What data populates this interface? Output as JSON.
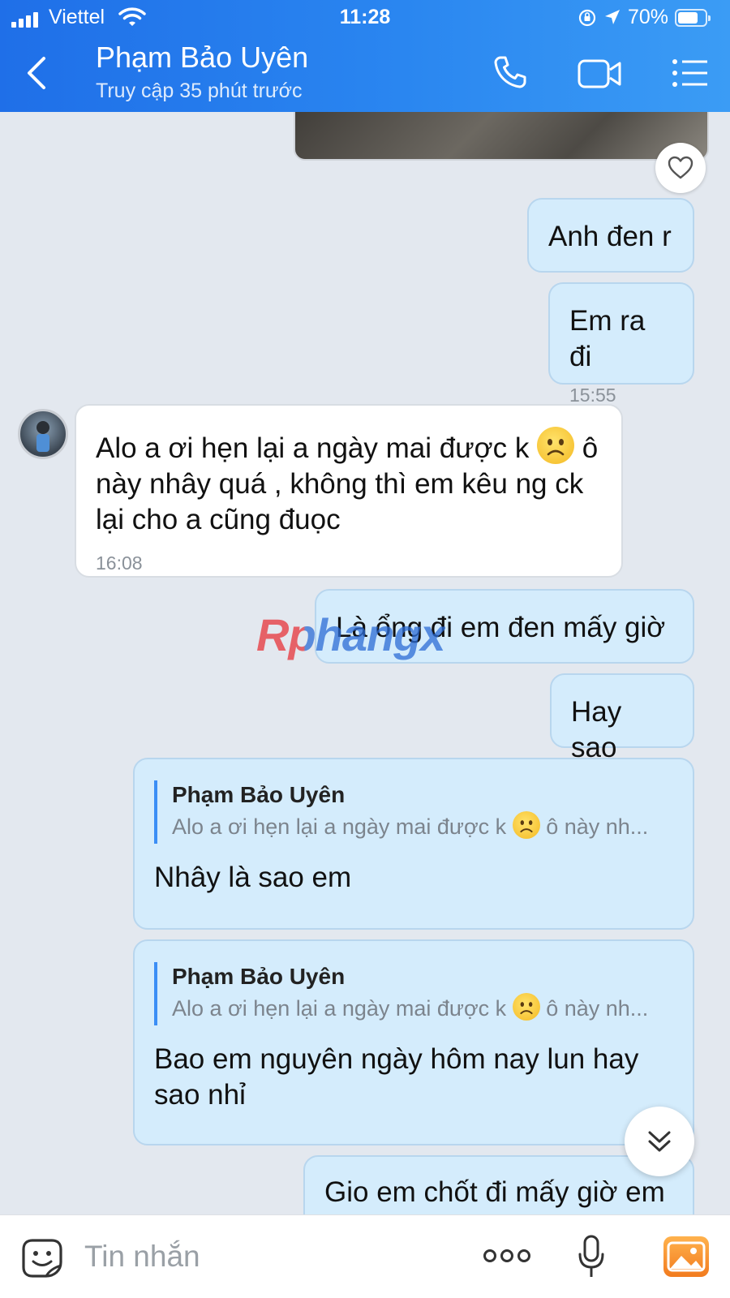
{
  "status_bar": {
    "carrier": "Viettel",
    "time": "11:28",
    "battery": "70%",
    "battery_level": 0.7
  },
  "header": {
    "contact_name": "Phạm Bảo Uyên",
    "contact_status": "Truy cập 35 phút trước"
  },
  "messages": [
    {
      "side": "out",
      "text": "Anh đen r"
    },
    {
      "side": "out",
      "text": "Em ra đi",
      "time": "15:55"
    },
    {
      "side": "in",
      "text_before_emoji": "Alo a ơi hẹn lại a ngày mai được k",
      "text_after_emoji": "ô",
      "text_line2": "này nhây quá , không thì em kêu ng ck",
      "text_line3": "lại cho a cũng đuọc",
      "time": "16:08"
    },
    {
      "side": "out",
      "text": "Là ổng đi em đen mấy giờ"
    },
    {
      "side": "out",
      "text": "Hay sao"
    },
    {
      "side": "out",
      "reply_author": "Phạm Bảo Uyên",
      "reply_text_before": "Alo a ơi hẹn lại a ngày mai được k",
      "reply_text_after": "ô này nh...",
      "text": "Nhây là sao em"
    },
    {
      "side": "out",
      "reply_author": "Phạm Bảo Uyên",
      "reply_text_before": "Alo a ơi hẹn lại a ngày mai được k",
      "reply_text_after": "ô này nh...",
      "text_line1": "Bao em nguyên ngày hôm nay lun hay",
      "text_line2": "sao nhỉ"
    },
    {
      "side": "out",
      "text": "Gio em chốt đi mấy giờ em"
    }
  ],
  "watermark": "Rphangx",
  "footer": {
    "placeholder": "Tin nhắn"
  },
  "colors": {
    "header_gradient_start": "#1f6fe8",
    "header_gradient_end": "#3b9cf5",
    "outgoing_bubble": "#d4ecfc",
    "incoming_bubble": "#ffffff",
    "chat_background": "#e3e8ef",
    "reply_accent": "#3b8ef5"
  }
}
